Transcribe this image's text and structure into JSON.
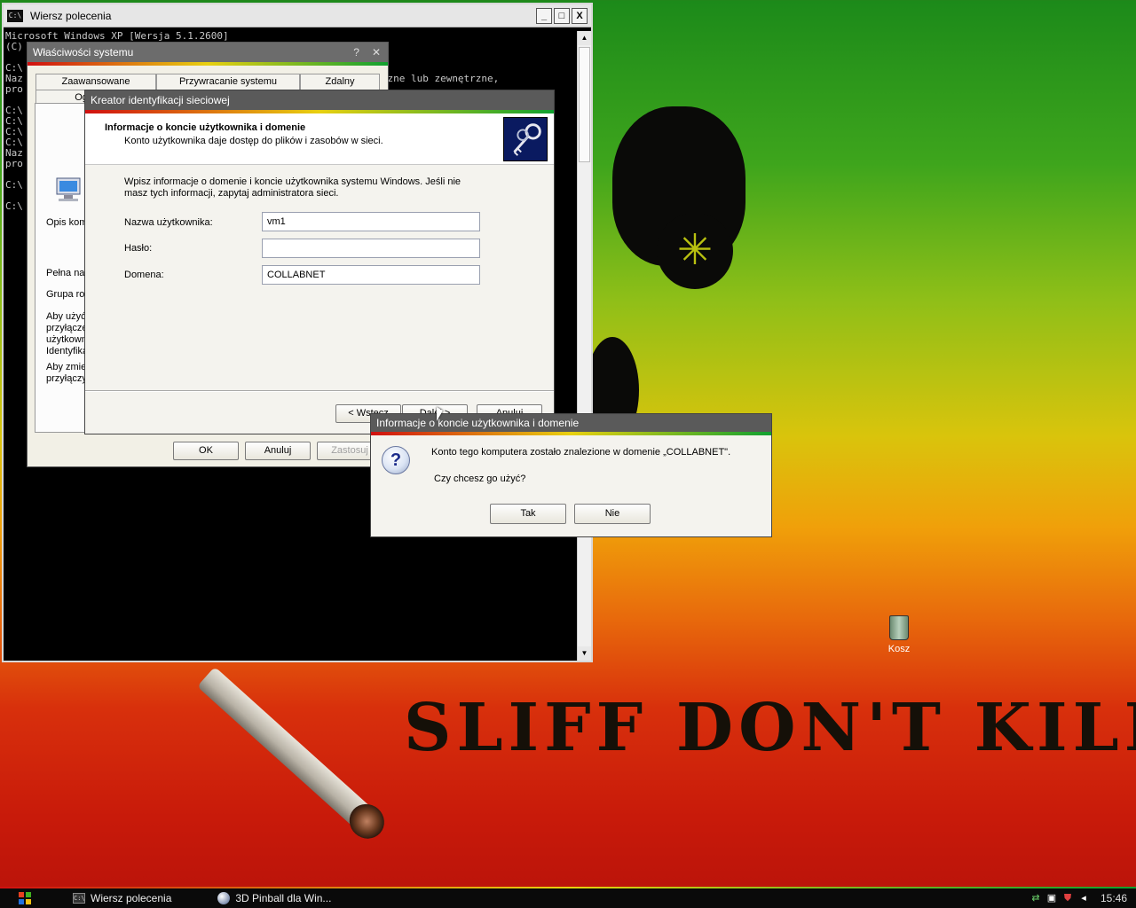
{
  "wallpaper": {
    "slogan": "SLIFF DON'T KILL"
  },
  "cmd": {
    "title": "Wiersz polecenia",
    "console_lines": [
      "Microsoft Windows XP [Wersja 5.1.2600]",
      "(C) Copyright 1985-2001 Microsoft Corp.",
      "",
      "C:\\",
      "Naz                                                         wnętrzne lub zewnętrzne,",
      "pro",
      "",
      "C:\\",
      "C:\\",
      "C:\\",
      "C:\\",
      "Naz",
      "pro",
      "",
      "C:\\",
      "",
      "C:\\"
    ],
    "minimize": "_",
    "maximize": "□",
    "close": "X"
  },
  "sysprops": {
    "title": "Właściwości systemu",
    "tabs": [
      "Zaawansowane",
      "Przywracanie systemu",
      "Zdalny",
      "Ogó"
    ],
    "labels": {
      "opis": "Opis kom",
      "pelna": "Pełna na",
      "grupa": "Grupa rol",
      "aby1": "Aby użyć\nprzyłącze\nużytkowni\nIdentyfika",
      "aby2": "Aby zmie\nprzyłączy"
    },
    "buttons": {
      "ok": "OK",
      "cancel": "Anuluj",
      "apply": "Zastosuj"
    }
  },
  "wizard": {
    "title": "Kreator identyfikacji sieciowej",
    "header_title": "Informacje o koncie użytkownika i domenie",
    "header_subtitle": "Konto użytkownika daje dostęp do plików i zasobów w sieci.",
    "instructions": "Wpisz informacje o domenie i koncie użytkownika systemu Windows. Jeśli nie masz tych informacji, zapytaj administratora sieci.",
    "fields": {
      "username_label": "Nazwa użytkownika:",
      "username_value": "vm1",
      "password_label": "Hasło:",
      "password_value": "",
      "domain_label": "Domena:",
      "domain_value": "COLLABNET"
    },
    "buttons": {
      "back": "< Wstecz",
      "next": "Dalej >",
      "cancel": "Anuluj"
    }
  },
  "msgbox": {
    "title": "Informacje o koncie użytkownika i domenie",
    "message": "Konto tego komputera zostało znalezione w domenie „COLLABNET\".",
    "question": "Czy chcesz go użyć?",
    "buttons": {
      "yes": "Tak",
      "no": "Nie"
    }
  },
  "desktop": {
    "recycle_bin": "Kosz"
  },
  "taskbar": {
    "tasks": [
      {
        "label": "Wiersz polecenia",
        "icon": "C:\\"
      },
      {
        "label": "3D Pinball dla Win...",
        "icon": "pinball"
      }
    ],
    "clock": "15:46"
  }
}
